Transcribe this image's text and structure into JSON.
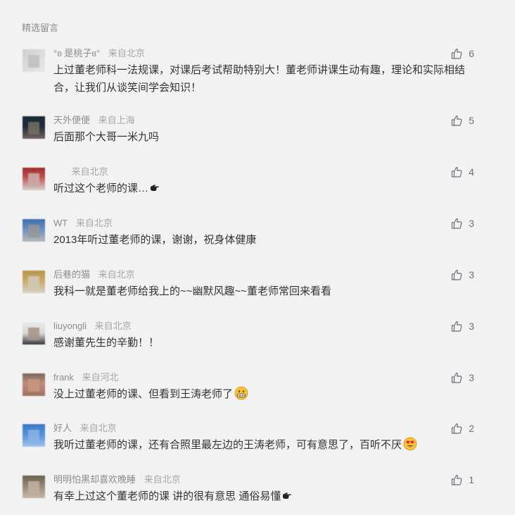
{
  "section_title": "精选留言",
  "comments": [
    {
      "nickname": "°ʚ 是桃子ɞ°",
      "location": "来自北京",
      "text": "上过董老师科一法规课，对课后考试帮助特别大！董老师讲课生动有趣，理论和实际相结合，让我们从谈笑间学会知识！",
      "likes": "6",
      "avatar_colors": [
        "#cfcfcf",
        "#e8e8e8"
      ]
    },
    {
      "nickname": "天外便便",
      "location": "来自上海",
      "text": "后面那个大哥一米九吗",
      "likes": "5",
      "avatar_colors": [
        "#1f2a3a",
        "#6f6560"
      ]
    },
    {
      "nickname": "",
      "location": "来自北京",
      "text": "听过这个老师的课…",
      "likes": "4",
      "avatar_colors": [
        "#a02b2b",
        "#d9d0d0"
      ]
    },
    {
      "nickname": "WT",
      "location": "来自北京",
      "text": "2013年听过董老师的课，谢谢，祝身体健康",
      "likes": "3",
      "avatar_colors": [
        "#3f6fa8",
        "#b9b9b9"
      ]
    },
    {
      "nickname": "后巷的猫",
      "location": "来自北京",
      "text": "我科一就是董老师给我上的~~幽默风趣~~董老师常回来看看",
      "likes": "3",
      "avatar_colors": [
        "#b8944a",
        "#d8d2c4"
      ]
    },
    {
      "nickname": "liuyongli",
      "location": "来自北京",
      "text": "感谢董先生的辛勤！！",
      "likes": "3",
      "avatar_colors": [
        "#eaeaea",
        "#3a3a3a"
      ]
    },
    {
      "nickname": "frank",
      "location": "来自河北",
      "text": "没上过董老师的课、但看到王涛老师了",
      "likes": "3",
      "avatar_colors": [
        "#c48a78",
        "#7a6a60"
      ]
    },
    {
      "nickname": "好人",
      "location": "来自北京",
      "text": "我听过董老师的课，还有合照里最左边的王涛老师，可有意思了，百听不厌",
      "likes": "2",
      "avatar_colors": [
        "#3a78c9",
        "#9cc3ee"
      ]
    },
    {
      "nickname": "明明怕黑却喜欢晚睡",
      "location": "来自北京",
      "text": "有幸上过这个董老师的课 讲的很有意思 通俗易懂",
      "likes": "1",
      "avatar_colors": [
        "#6d6050",
        "#c9b9a8"
      ]
    }
  ],
  "icons": {
    "like": "thumbs-up-icon",
    "hand": "pointing-hand-emoji",
    "grin": "grinning-face-emoji",
    "hearts": "heart-eyes-emoji"
  },
  "colors": {
    "background": "#f2f2f2",
    "text": "#333333",
    "meta": "#8c8c8c",
    "like_icon": "#6a6f78"
  }
}
